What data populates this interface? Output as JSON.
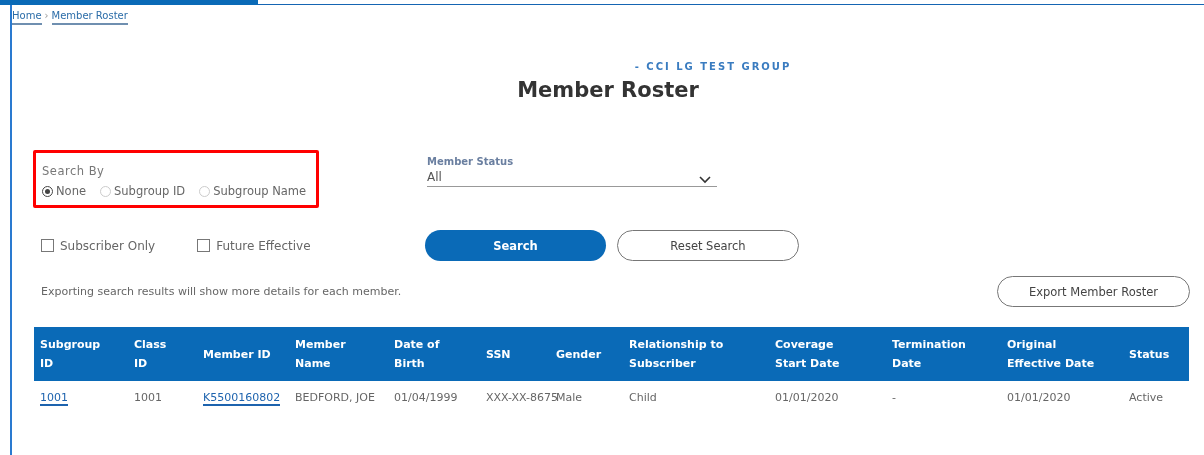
{
  "breadcrumb": [
    "Home",
    "Member Roster"
  ],
  "breadcrumb_separator": "›",
  "group_name": "- CCI LG TEST GROUP",
  "title": "Member Roster",
  "search_by": {
    "label": "Search By",
    "options": [
      {
        "label": "None",
        "selected": true
      },
      {
        "label": "Subgroup ID",
        "selected": false
      },
      {
        "label": "Subgroup Name",
        "selected": false
      }
    ]
  },
  "member_status": {
    "label": "Member Status",
    "value": "All"
  },
  "checkboxes": [
    {
      "label": "Subscriber Only",
      "checked": false
    },
    {
      "label": "Future Effective",
      "checked": false
    }
  ],
  "buttons": {
    "search": "Search",
    "reset": "Reset Search",
    "export": "Export Member Roster"
  },
  "export_note": "Exporting search results will show more details for each member.",
  "table": {
    "columns": [
      "Subgroup ID",
      "Class ID",
      "Member ID",
      "Member Name",
      "Date of Birth",
      "SSN",
      "Gender",
      "Relationship to Subscriber",
      "Coverage Start Date",
      "Termination Date",
      "Original Effective Date",
      "Status"
    ],
    "rows": [
      [
        "1001",
        "1001",
        "K5500160802",
        "BEDFORD, JOE",
        "01/04/1999",
        "XXX-XX-8675",
        "Male",
        "Child",
        "01/01/2020",
        "-",
        "01/01/2020",
        "Active"
      ]
    ]
  }
}
